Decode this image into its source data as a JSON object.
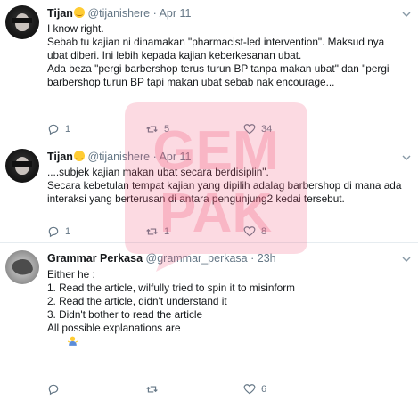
{
  "tweets": [
    {
      "name": "Tijan",
      "emoji": "smiling-face-emoji",
      "handle": "@tijanishere",
      "separator": "·",
      "date": "Apr 11",
      "lines": [
        "I know right.",
        "",
        "Sebab tu kajian ni dinamakan \"pharmacist-led intervention\". Maksud nya",
        "ubat diberi. Ini lebih kepada kajian keberkesanan ubat.",
        "",
        "Ada beza \"pergi barbershop terus turun BP tanpa makan ubat\" dan \"pergi",
        "barbershop turun BP tapi makan ubat sebab nak encourage..."
      ],
      "replies": "1",
      "retweets": "5",
      "likes": "34"
    },
    {
      "name": "Tijan",
      "emoji": "smiling-face-emoji",
      "handle": "@tijanishere",
      "separator": "·",
      "date": "Apr 11",
      "lines": [
        "....subjek kajian makan ubat secara berdisiplin\".",
        "",
        "Secara kebetulan tempat kajian yang dipilih adalag barbershop di mana ada",
        "interaksi yang berterusan di antara pengunjung2 kedai tersebut."
      ],
      "replies": "1",
      "retweets": "1",
      "likes": "8"
    },
    {
      "name": "Grammar Perkasa",
      "handle": "@grammar_perkasa",
      "separator": "·",
      "date": "23h",
      "lines": [
        "Either he :",
        "1. Read the article, wilfully tried to spin it to misinform",
        "",
        "2. Read the article, didn't understand it",
        "",
        "3. Didn't bother to read the article",
        "",
        "All possible explanations are"
      ],
      "end_emoji": "person-shrugging-emoji",
      "replies": "",
      "retweets": "",
      "likes": "6"
    }
  ],
  "watermark": {
    "text_top": "GEM",
    "text_bottom": "PAK",
    "color": "#f2587a"
  },
  "colors": {
    "text": "#14171a",
    "secondary": "#657786",
    "divider": "#e6ecf0"
  }
}
